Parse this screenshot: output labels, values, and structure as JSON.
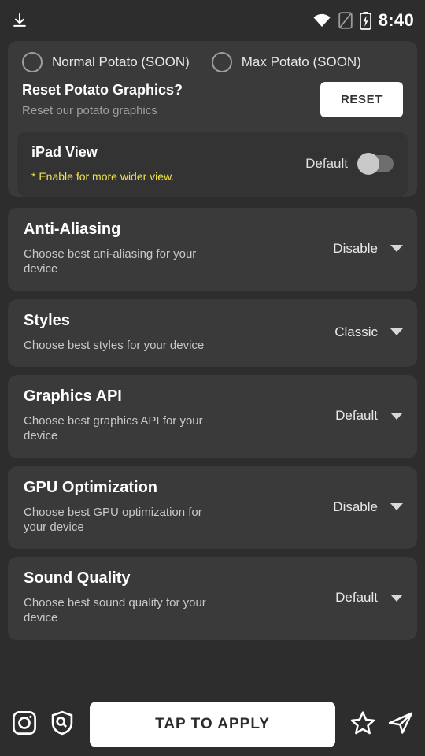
{
  "statusbar": {
    "time": "8:40",
    "icons": [
      "download-icon",
      "wifi-icon",
      "sim-off-icon",
      "battery-charging-icon"
    ]
  },
  "potato": {
    "options": [
      {
        "label": "Normal Potato (SOON)",
        "selected": false
      },
      {
        "label": "Max Potato (SOON)",
        "selected": false
      }
    ],
    "reset_title": "Reset Potato  Graphics?",
    "reset_sub": "Reset our potato graphics",
    "reset_button": "RESET"
  },
  "ipad_view": {
    "title": "iPad View",
    "note": "* Enable for more wider view.",
    "toggle_label": "Default",
    "toggle_on": false
  },
  "settings": [
    {
      "title": "Anti-Aliasing",
      "subtitle": "Choose best ani-aliasing for your device",
      "value": "Disable"
    },
    {
      "title": "Styles",
      "subtitle": "Choose best styles for your device",
      "value": "Classic"
    },
    {
      "title": "Graphics API",
      "subtitle": "Choose best graphics API for your device",
      "value": "Default"
    },
    {
      "title": "GPU Optimization",
      "subtitle": "Choose best GPU optimization for your device",
      "value": "Disable"
    },
    {
      "title": "Sound Quality",
      "subtitle": "Choose best sound quality for your device",
      "value": "Default"
    }
  ],
  "bottombar": {
    "apply_label": "TAP TO APPLY",
    "left_icons": [
      "instagram-icon",
      "shield-search-icon"
    ],
    "right_icons": [
      "star-icon",
      "send-icon"
    ]
  },
  "colors": {
    "background": "#2d2d2d",
    "card": "#3a3a3a",
    "inner_card": "#333333",
    "accent_yellow": "#f2e34a",
    "white": "#ffffff"
  }
}
